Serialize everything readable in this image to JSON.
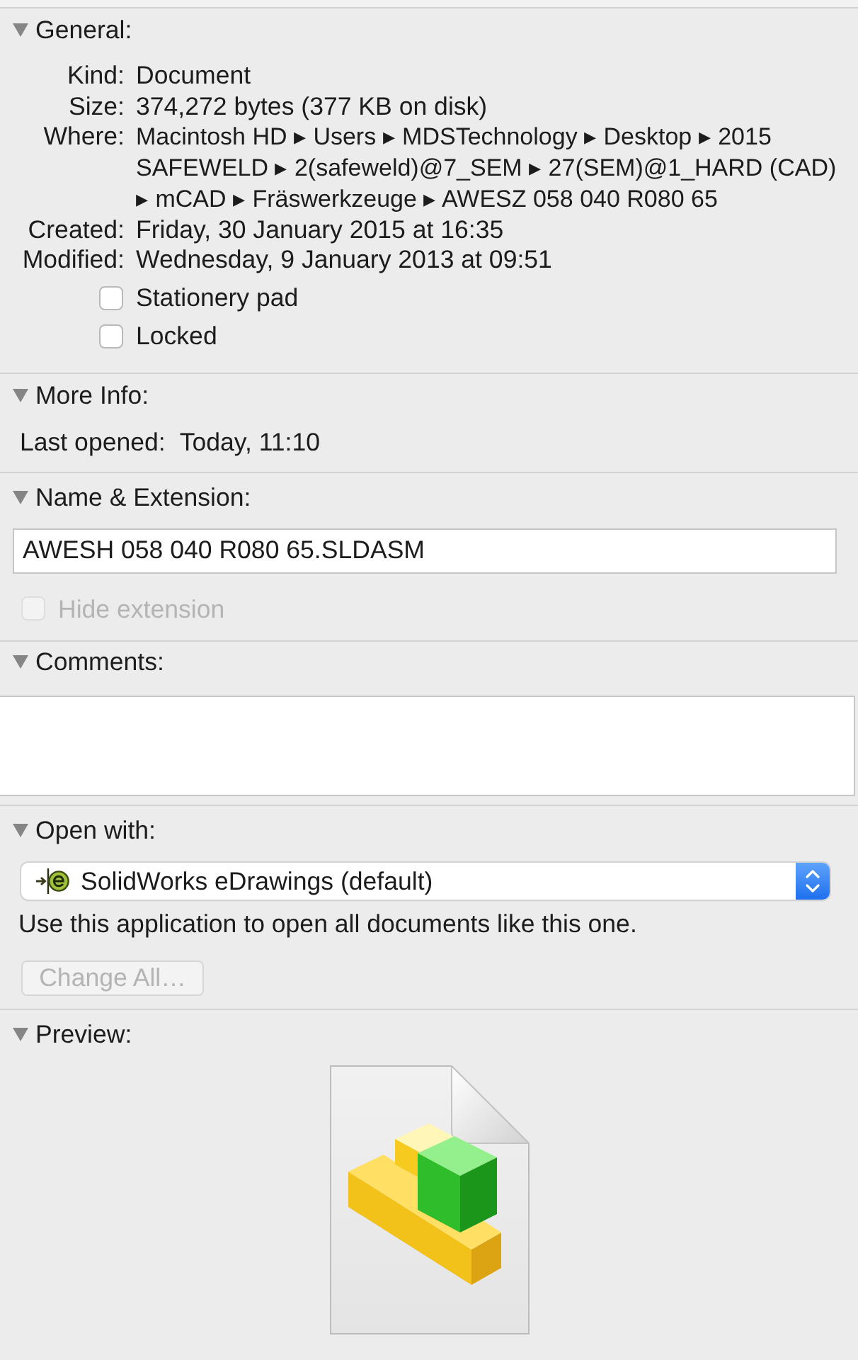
{
  "general": {
    "title": "General:",
    "expanded": true,
    "fields": [
      {
        "kind": "text",
        "label": "Kind:",
        "value": "Document"
      },
      {
        "kind": "text",
        "label": "Size:",
        "value": "374,272 bytes (377 KB on disk)"
      },
      {
        "kind": "path",
        "label": "Where:",
        "value": "Macintosh HD ▸ Users ▸ MDSTechnology ▸ Desktop ▸ 2015 SAFEWELD ▸ 2(safeweld)@7_SEM ▸ 27(SEM)@1_HARD (CAD) ▸ mCAD ▸ Fräswerkzeuge ▸ AWESZ 058 040 R080 65"
      },
      {
        "kind": "text",
        "label": "Created:",
        "value": "Friday, 30 January 2015 at 16:35"
      },
      {
        "kind": "text",
        "label": "Modified:",
        "value": "Wednesday, 9 January 2013 at 09:51"
      }
    ],
    "checkboxes": [
      {
        "label": "Stationery pad",
        "checked": false
      },
      {
        "label": "Locked",
        "checked": false
      }
    ]
  },
  "more_info": {
    "title": "More Info:",
    "expanded": true,
    "fields": [
      {
        "label": "Last opened:",
        "value": "Today, 11:10"
      }
    ]
  },
  "name_extension": {
    "title": "Name & Extension:",
    "expanded": true,
    "value": "AWESH 058 040 R080 65.SLDASM",
    "hide_extension": {
      "label": "Hide extension",
      "checked": false,
      "disabled": true
    }
  },
  "comments": {
    "title": "Comments:",
    "expanded": true
  },
  "open_with": {
    "title": "Open with:",
    "expanded": true,
    "application": "SolidWorks eDrawings (default)",
    "note": "Use this application to open all documents like this one.",
    "change_all": {
      "label": "Change All…",
      "disabled": true
    }
  },
  "preview": {
    "title": "Preview:",
    "expanded": true
  }
}
